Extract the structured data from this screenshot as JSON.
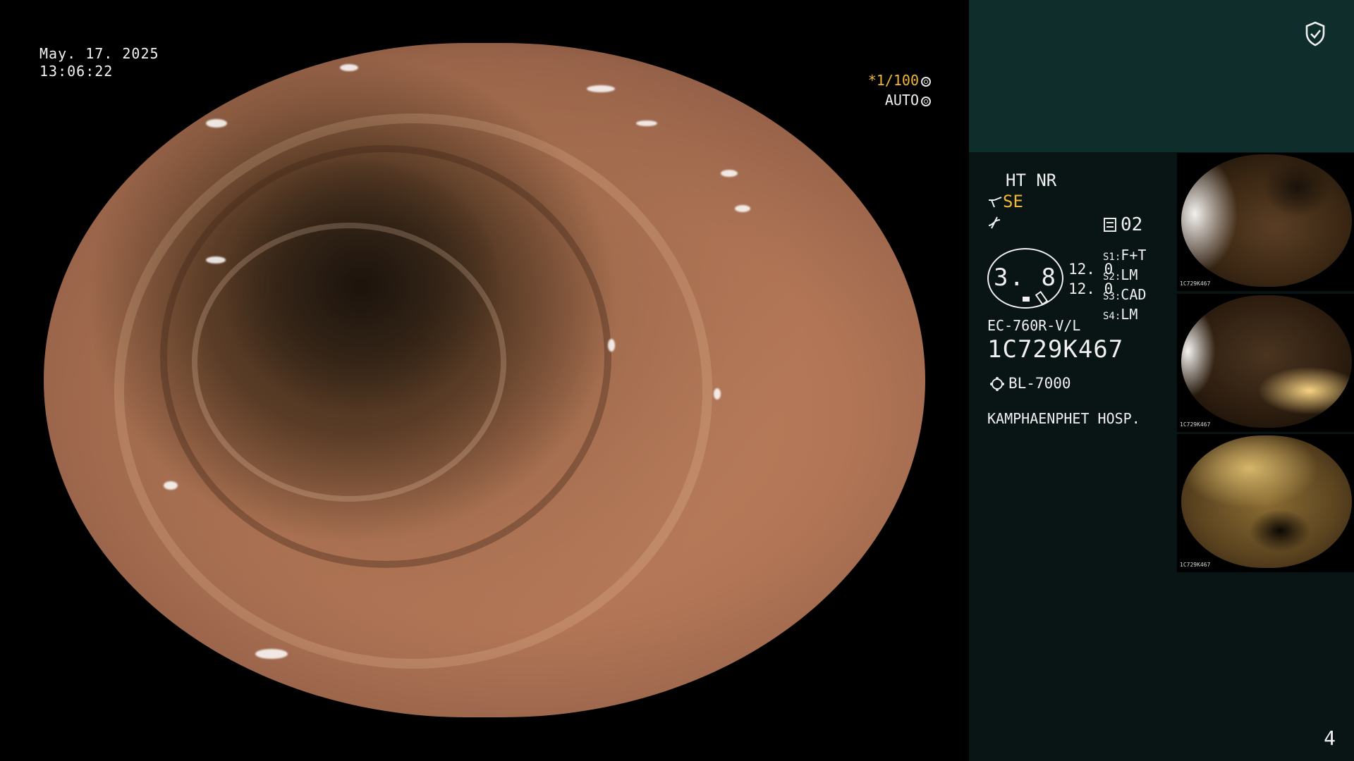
{
  "overlay": {
    "date": "May. 17. 2025",
    "time": "13:06:22",
    "shutter_prefix": "*",
    "shutter": "1/100",
    "iris": "AUTO"
  },
  "panel": {
    "enhancement": "HT NR",
    "structure_mode": "SE",
    "menu_number": "02",
    "gauge_value": "3. 8",
    "side_value_1": "12. 0",
    "side_value_2": "12. 0",
    "switches": [
      {
        "key": "S1",
        "value": "F+T"
      },
      {
        "key": "S2",
        "value": "LM"
      },
      {
        "key": "S3",
        "value": "CAD"
      },
      {
        "key": "S4",
        "value": "LM"
      }
    ],
    "scope_model": "EC-760R-V/L",
    "scope_serial": "1C729K467",
    "light_source": "BL-7000",
    "hospital": "KAMPHAENPHET HOSP."
  },
  "thumbnails": [
    {
      "caption": "1C729K467"
    },
    {
      "caption": "1C729K467"
    },
    {
      "caption": "1C729K467"
    }
  ],
  "page_number": "4",
  "colors": {
    "accent": "#f2b636",
    "panel_top": "#0e2d2b",
    "panel_bg": "#081514"
  }
}
